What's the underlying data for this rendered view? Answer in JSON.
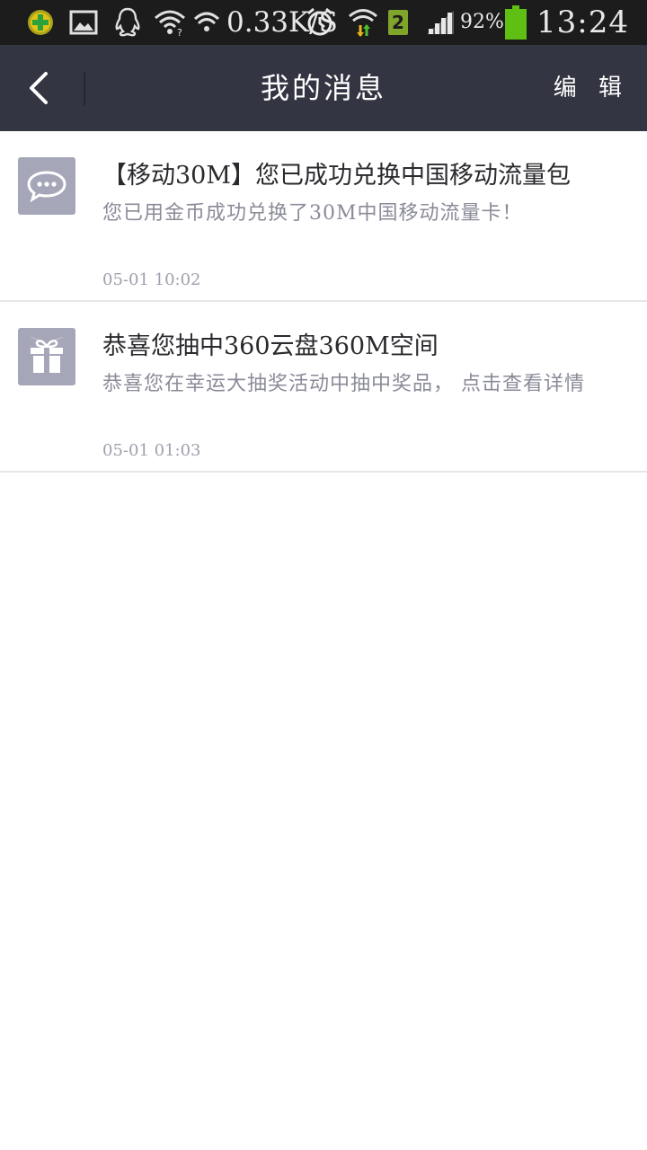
{
  "status_bar": {
    "net_speed": "0.33K/S",
    "sim_badge": "2",
    "battery_percent": "92%",
    "battery_level": 0.92,
    "time": "13:24",
    "icons": [
      "360-security-icon",
      "image-notification-icon",
      "qq-icon",
      "wifi-hotspot-icon",
      "wifi-icon",
      "alarm-icon",
      "wifi-data-icon",
      "sim-2-icon",
      "signal-icon",
      "battery-icon"
    ]
  },
  "nav": {
    "back_icon": "chevron-left-icon",
    "title": "我的消息",
    "edit_label": "编 辑"
  },
  "messages": [
    {
      "icon": "chat-bubble-icon",
      "title": "【移动30M】您已成功兑换中国移动流量包",
      "description": "您已用金币成功兑换了30M中国移动流量卡！",
      "time": "05-01 10:02"
    },
    {
      "icon": "gift-icon",
      "title": "恭喜您抽中360云盘360M空间",
      "description": "恭喜您在幸运大抽奖活动中抽中奖品， 点击查看详情",
      "time": "05-01 01:03"
    }
  ],
  "colors": {
    "status_bar_bg": "#1c1c1c",
    "nav_bar_bg": "#343543",
    "icon_bg": "#a5a7b9",
    "battery_green": "#5fbf12",
    "title_text": "#2a2a2e",
    "desc_text": "#8a8b98"
  }
}
